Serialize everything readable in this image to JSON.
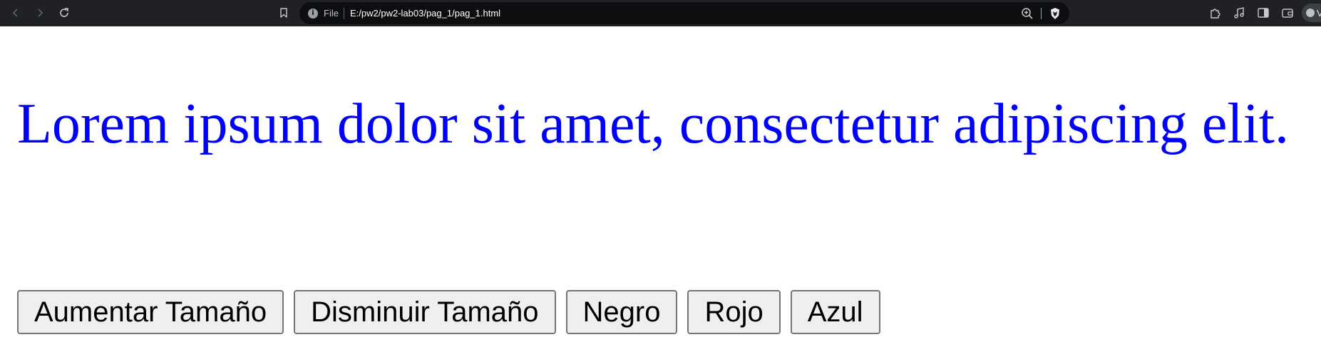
{
  "browser": {
    "scheme_label": "File",
    "url": "E:/pw2/pw2-lab03/pag_1/pag_1.html",
    "profile_initial": "V",
    "icons": {
      "back": "arrow-left-icon",
      "forward": "arrow-right-icon",
      "reload": "reload-icon",
      "bookmark": "bookmark-icon",
      "info": "info-icon",
      "zoom": "zoom-in-icon",
      "shields": "brave-shield-icon",
      "extensions": "puzzle-icon",
      "media": "music-note-icon",
      "sidebar": "sidebar-icon",
      "wallet": "wallet-icon"
    }
  },
  "page": {
    "paragraph": "Lorem ipsum dolor sit amet, consectetur adipiscing elit.",
    "text_color": "#0000ff",
    "buttons": [
      {
        "label": "Aumentar Tamaño"
      },
      {
        "label": "Disminuir Tamaño"
      },
      {
        "label": "Negro"
      },
      {
        "label": "Rojo"
      },
      {
        "label": "Azul"
      }
    ]
  }
}
